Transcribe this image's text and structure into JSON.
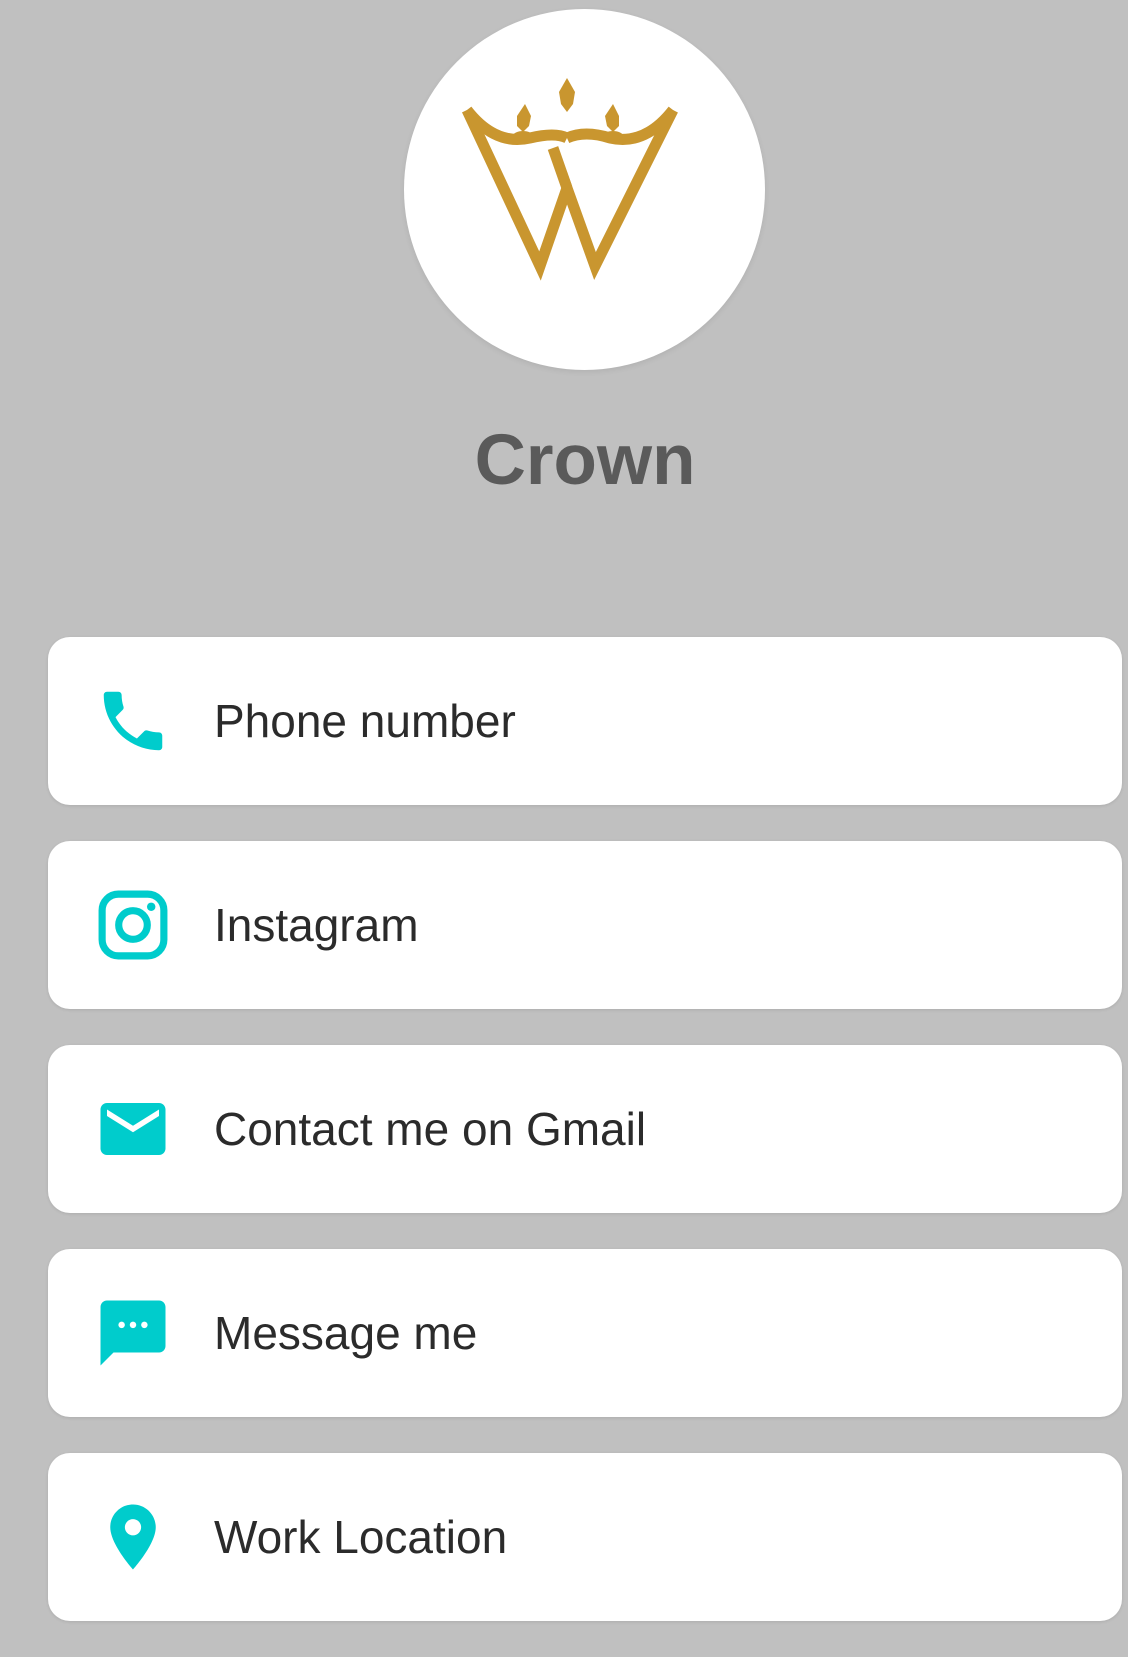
{
  "profile": {
    "name": "Crown",
    "logo_icon": "crown-w-icon",
    "logo_color": "#c9962f"
  },
  "links": [
    {
      "label": "Phone number",
      "icon": "phone-icon"
    },
    {
      "label": "Instagram",
      "icon": "instagram-icon"
    },
    {
      "label": "Contact me on Gmail",
      "icon": "mail-icon"
    },
    {
      "label": "Message me",
      "icon": "message-icon"
    },
    {
      "label": "Work Location",
      "icon": "location-pin-icon"
    }
  ],
  "colors": {
    "background": "#c0c0c0",
    "accent": "#00cccc",
    "card": "#ffffff",
    "name_text": "#5a5a5a",
    "label_text": "#2b2b2b"
  }
}
